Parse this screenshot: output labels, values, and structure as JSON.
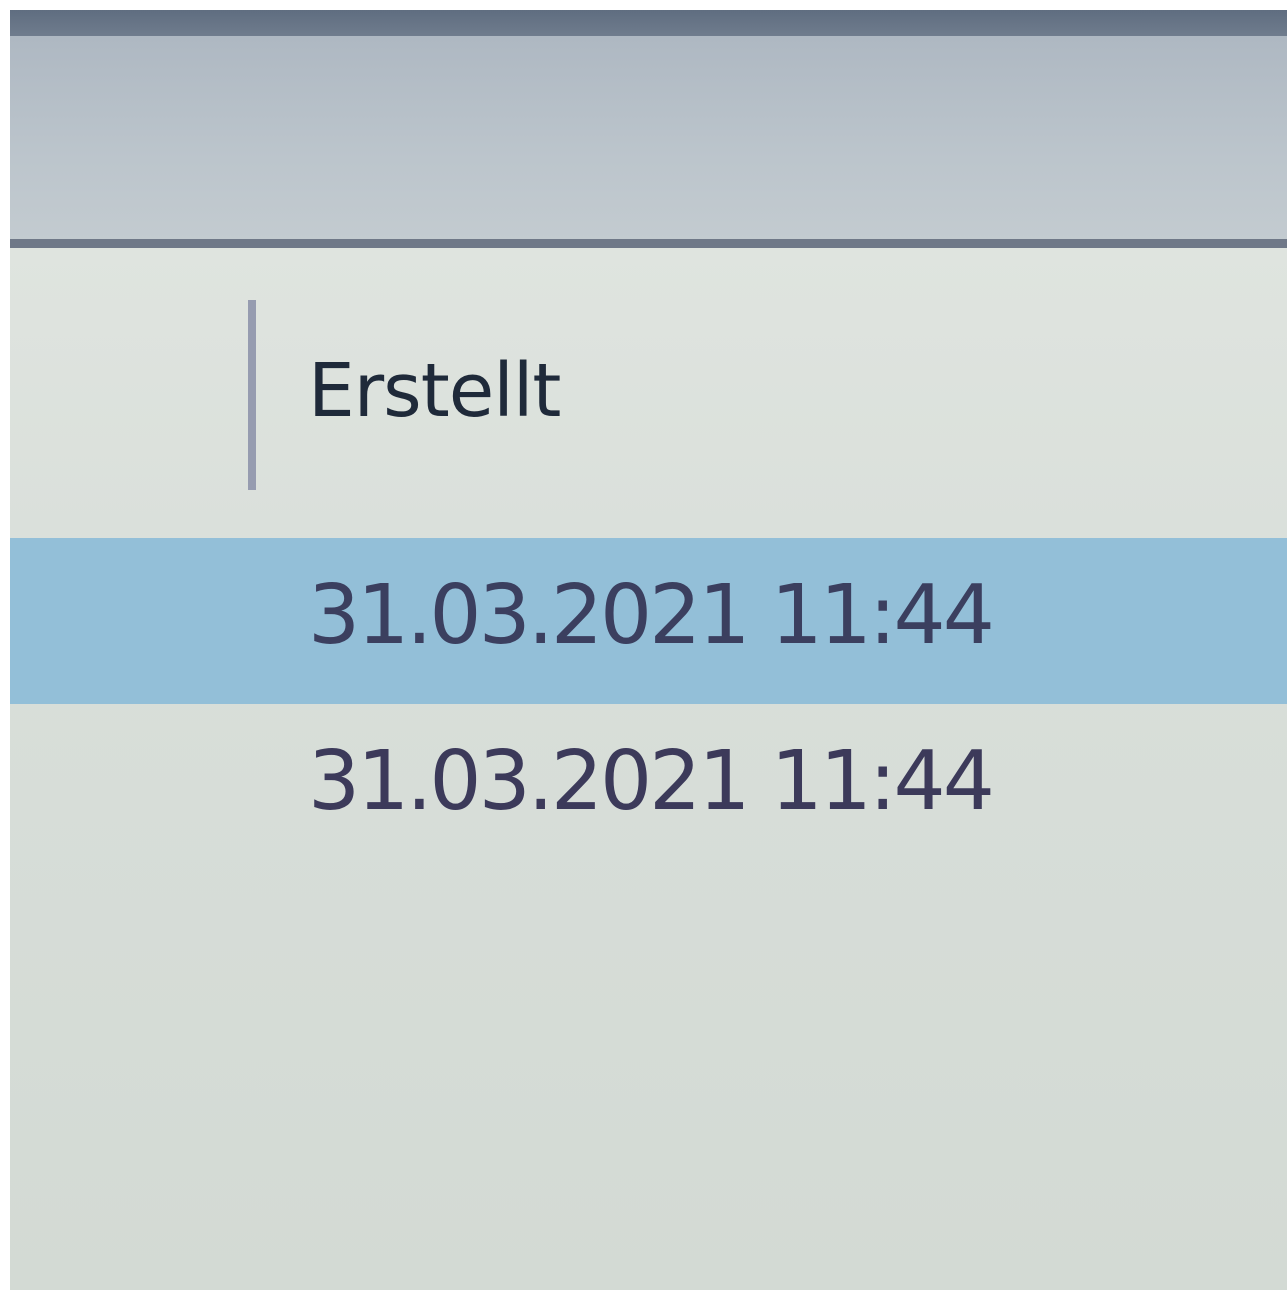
{
  "list": {
    "columns": [
      {
        "label": "Erstellt"
      }
    ],
    "rows": [
      {
        "created": "31.03.2021 11:44",
        "selected": true
      },
      {
        "created": "31.03.2021 11:44",
        "selected": false
      }
    ]
  },
  "colors": {
    "selection": "#93bfd8",
    "background": "#d8ded9",
    "text": "#3c3a5a"
  }
}
